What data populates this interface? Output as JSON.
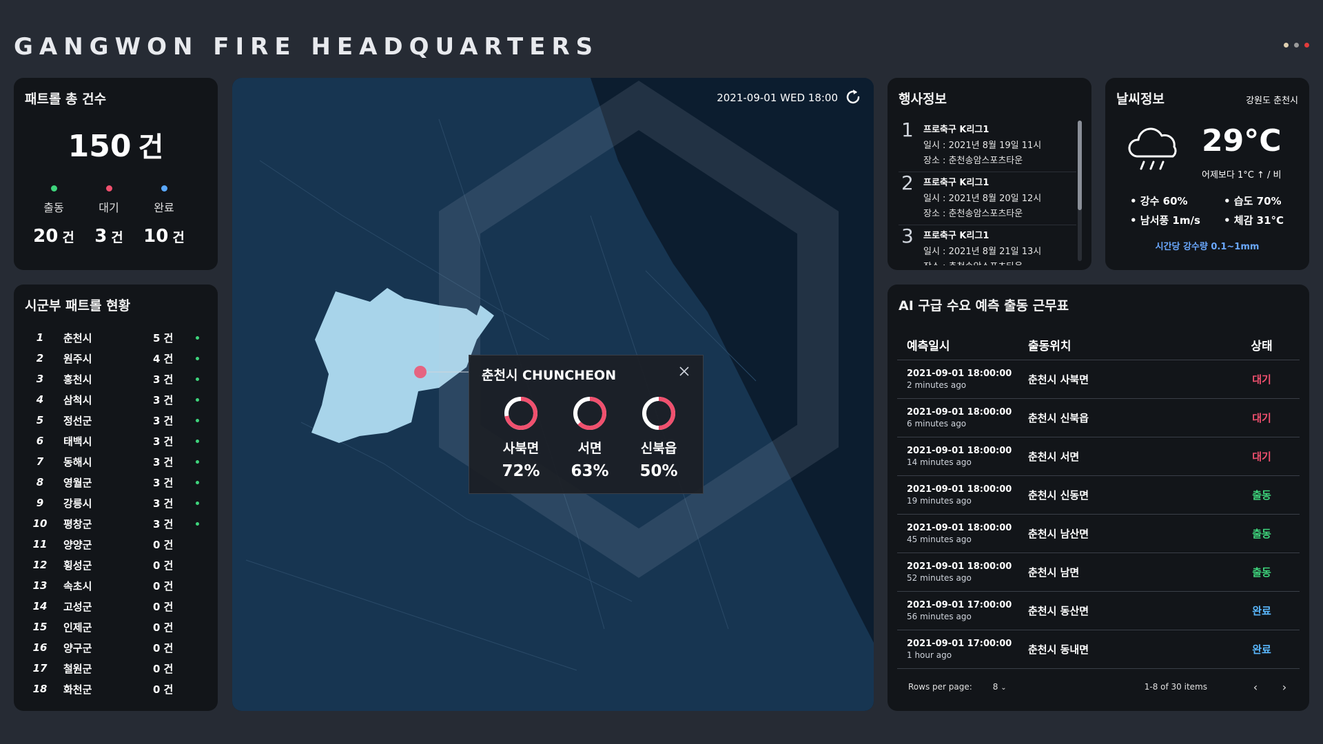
{
  "app": {
    "title": "GANGWON FIRE HEADQUARTERS",
    "window_dot_colors": [
      "#e0d0b0",
      "#9a9a9a",
      "#e23b3b"
    ]
  },
  "patrol_total": {
    "title": "패트롤 총 건수",
    "total_value": "150",
    "unit": "건",
    "stats": [
      {
        "label": "출동",
        "value": "20",
        "color": "#3ed47c"
      },
      {
        "label": "대기",
        "value": "3",
        "color": "#f0506e"
      },
      {
        "label": "완료",
        "value": "10",
        "color": "#5aa8ff"
      }
    ]
  },
  "district": {
    "title": "시군부 패트롤 현황",
    "unit": "건",
    "rows": [
      {
        "rank": "1",
        "name": "춘천시",
        "count": "5",
        "dot": true
      },
      {
        "rank": "2",
        "name": "원주시",
        "count": "4",
        "dot": true
      },
      {
        "rank": "3",
        "name": "홍천시",
        "count": "3",
        "dot": true
      },
      {
        "rank": "4",
        "name": "삼척시",
        "count": "3",
        "dot": true
      },
      {
        "rank": "5",
        "name": "정선군",
        "count": "3",
        "dot": true
      },
      {
        "rank": "6",
        "name": "태백시",
        "count": "3",
        "dot": true
      },
      {
        "rank": "7",
        "name": "동해시",
        "count": "3",
        "dot": true
      },
      {
        "rank": "8",
        "name": "영월군",
        "count": "3",
        "dot": true
      },
      {
        "rank": "9",
        "name": "강릉시",
        "count": "3",
        "dot": true
      },
      {
        "rank": "10",
        "name": "평창군",
        "count": "3",
        "dot": true
      },
      {
        "rank": "11",
        "name": "양양군",
        "count": "0",
        "dot": false
      },
      {
        "rank": "12",
        "name": "횡성군",
        "count": "0",
        "dot": false
      },
      {
        "rank": "13",
        "name": "속초시",
        "count": "0",
        "dot": false
      },
      {
        "rank": "14",
        "name": "고성군",
        "count": "0",
        "dot": false
      },
      {
        "rank": "15",
        "name": "인제군",
        "count": "0",
        "dot": false
      },
      {
        "rank": "16",
        "name": "양구군",
        "count": "0",
        "dot": false
      },
      {
        "rank": "17",
        "name": "철원군",
        "count": "0",
        "dot": false
      },
      {
        "rank": "18",
        "name": "화천군",
        "count": "0",
        "dot": false
      }
    ]
  },
  "map": {
    "datetime": "2021-09-01 WED 18:00",
    "refresh_icon": "refresh-icon",
    "colors": {
      "sea": "#0c1d2f",
      "land": "#173551",
      "highlight": "#a8d4ea",
      "marker": "#f0506e"
    },
    "popup": {
      "title": "춘천시 CHUNCHEON",
      "close_icon": "close-icon",
      "items": [
        {
          "name": "사북면",
          "value_label": "72%",
          "percent": 72
        },
        {
          "name": "서면",
          "value_label": "63%",
          "percent": 63
        },
        {
          "name": "신북읍",
          "value_label": "50%",
          "percent": 50
        }
      ]
    }
  },
  "events": {
    "title": "행사정보",
    "items": [
      {
        "num": "1",
        "title": "프로축구 K리그1",
        "date": "일시 : 2021년 8월 19일 11시",
        "place": "장소 : 춘천송암스포츠타운"
      },
      {
        "num": "2",
        "title": "프로축구 K리그1",
        "date": "일시 : 2021년 8월 20일 12시",
        "place": "장소 : 춘천송암스포츠타운"
      },
      {
        "num": "3",
        "title": "프로축구 K리그1",
        "date": "일시 : 2021년 8월 21일 13시",
        "place": "장소 : 춘천송암스포츠타운"
      }
    ]
  },
  "weather": {
    "title": "날씨정보",
    "location": "강원도 춘천시",
    "icon": "rain-cloud-icon",
    "temp": "29°C",
    "compare": "어제보다 1°C ↑ / 비",
    "rain_prob": "• 강수 60%",
    "humidity": "• 습도 70%",
    "wind": "• 남서풍 1m/s",
    "feels": "• 체감 31°C",
    "hourly_rain": "시간당 강수량 0.1~1mm"
  },
  "ai_table": {
    "title": "AI 구급 수요 예측 출동 근무표",
    "headers": {
      "time": "예측일시",
      "location": "출동위치",
      "status": "상태"
    },
    "status_colors": {
      "대기": "#f0506e",
      "출동": "#3ed47c",
      "완료": "#5ab8ff"
    },
    "rows": [
      {
        "time": "2021-09-01 18:00:00",
        "ago": "2 minutes ago",
        "location": "춘천시 사북면",
        "status": "대기"
      },
      {
        "time": "2021-09-01 18:00:00",
        "ago": "6 minutes ago",
        "location": "춘천시 신북읍",
        "status": "대기"
      },
      {
        "time": "2021-09-01 18:00:00",
        "ago": "14 minutes ago",
        "location": "춘천시 서면",
        "status": "대기"
      },
      {
        "time": "2021-09-01 18:00:00",
        "ago": "19 minutes ago",
        "location": "춘천시 신동면",
        "status": "출동"
      },
      {
        "time": "2021-09-01 18:00:00",
        "ago": "45 minutes ago",
        "location": "춘천시 남산면",
        "status": "출동"
      },
      {
        "time": "2021-09-01 18:00:00",
        "ago": "52 minutes ago",
        "location": "춘천시 남면",
        "status": "출동"
      },
      {
        "time": "2021-09-01 17:00:00",
        "ago": "56 minutes ago",
        "location": "춘천시 동산면",
        "status": "완료"
      },
      {
        "time": "2021-09-01 17:00:00",
        "ago": "1 hour ago",
        "location": "춘천시 동내면",
        "status": "완료"
      }
    ],
    "footer": {
      "rows_per_page_label": "Rows per page:",
      "rows_per_page_value": "8",
      "range": "1-8 of 30 items",
      "prev": "‹",
      "next": "›"
    }
  }
}
